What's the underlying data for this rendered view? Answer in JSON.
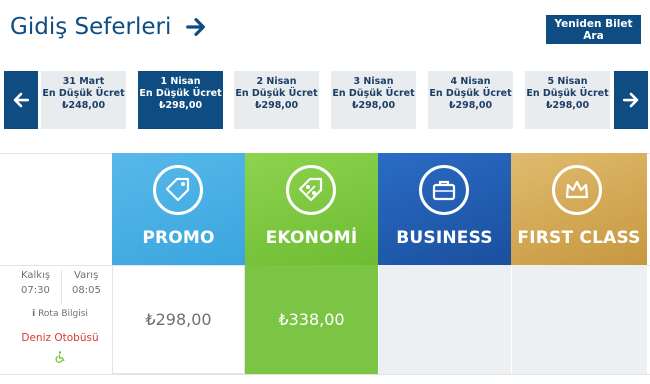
{
  "header": {
    "title": "Gidiş Seferleri",
    "retry_label": "Yeniden Bilet Ara"
  },
  "dates": [
    {
      "date": "31 Mart",
      "label": "En Düşük Ücret",
      "price": "₺248,00",
      "active": false
    },
    {
      "date": "1 Nisan",
      "label": "En Düşük Ücret",
      "price": "₺298,00",
      "active": true
    },
    {
      "date": "2 Nisan",
      "label": "En Düşük Ücret",
      "price": "₺298,00",
      "active": false
    },
    {
      "date": "3 Nisan",
      "label": "En Düşük Ücret",
      "price": "₺298,00",
      "active": false
    },
    {
      "date": "4 Nisan",
      "label": "En Düşük Ücret",
      "price": "₺298,00",
      "active": false
    },
    {
      "date": "5 Nisan",
      "label": "En Düşük Ücret",
      "price": "₺298,00",
      "active": false
    }
  ],
  "fares": [
    {
      "name": "PROMO",
      "icon": "tag-icon",
      "color": "#4aaee3"
    },
    {
      "name": "EKONOMİ",
      "icon": "percent-icon",
      "color": "#7cc443"
    },
    {
      "name": "BUSINESS",
      "icon": "briefcase-icon",
      "color": "#2360b5"
    },
    {
      "name": "FIRST CLASS",
      "icon": "crown-icon",
      "color": "#d4aa55"
    }
  ],
  "journey": {
    "departure_label": "Kalkış",
    "departure_time": "07:30",
    "arrival_label": "Varış",
    "arrival_time": "08:05",
    "route_info": "Rota Bilgisi",
    "bus_type": "Deniz Otobüsü",
    "prices": {
      "promo": "₺298,00",
      "ekonomi": "₺338,00"
    }
  }
}
